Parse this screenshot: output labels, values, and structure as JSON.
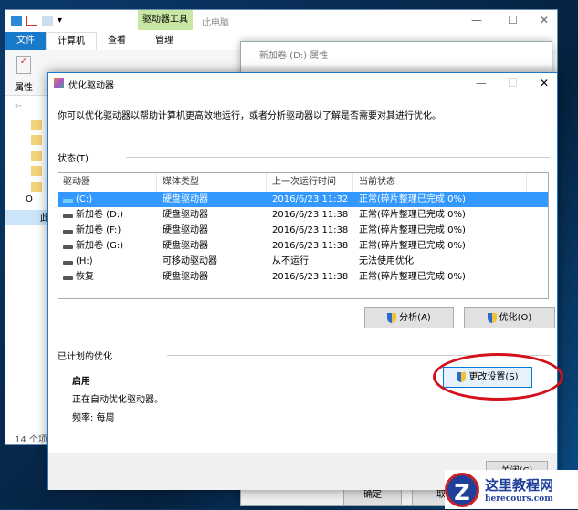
{
  "explorer": {
    "title": "此电脑",
    "context_tab": "驱动器工具",
    "tabs": [
      "文件",
      "计算机",
      "查看",
      "管理"
    ],
    "ribbon_properties": "属性",
    "status": "14 个项",
    "nav_partial": [
      "O",
      "此"
    ]
  },
  "properties": {
    "title": "新加卷 (D:) 属性",
    "buttons": [
      "确定",
      "取"
    ]
  },
  "dialog": {
    "title": "优化驱动器",
    "description": "你可以优化驱动器以帮助计算机更高效地运行，或者分析驱动器以了解是否需要对其进行优化。",
    "status_label": "状态(T)",
    "columns": [
      "驱动器",
      "媒体类型",
      "上一次运行时间",
      "当前状态"
    ],
    "rows": [
      {
        "drive": "(C:)",
        "media": "硬盘驱动器",
        "last": "2016/6/23 11:32",
        "state": "正常(碎片整理已完成 0%)"
      },
      {
        "drive": "新加卷 (D:)",
        "media": "硬盘驱动器",
        "last": "2016/6/23 11:38",
        "state": "正常(碎片整理已完成 0%)"
      },
      {
        "drive": "新加卷 (F:)",
        "media": "硬盘驱动器",
        "last": "2016/6/23 11:38",
        "state": "正常(碎片整理已完成 0%)"
      },
      {
        "drive": "新加卷 (G:)",
        "media": "硬盘驱动器",
        "last": "2016/6/23 11:38",
        "state": "正常(碎片整理已完成 0%)"
      },
      {
        "drive": "(H:)",
        "media": "可移动驱动器",
        "last": "从不运行",
        "state": "无法使用优化"
      },
      {
        "drive": "恢复",
        "media": "硬盘驱动器",
        "last": "2016/6/23 11:38",
        "state": "正常(碎片整理已完成 0%)"
      }
    ],
    "analyze": "分析(A)",
    "optimize": "优化(O)",
    "scheduled_label": "已计划的优化",
    "enabled": "启用",
    "auto_text": "正在自动优化驱动器。",
    "frequency": "频率: 每周",
    "change_settings": "更改设置(S)",
    "close": "关闭(C)"
  },
  "watermark": {
    "name": "这里教程网",
    "url": "herecours.com"
  }
}
